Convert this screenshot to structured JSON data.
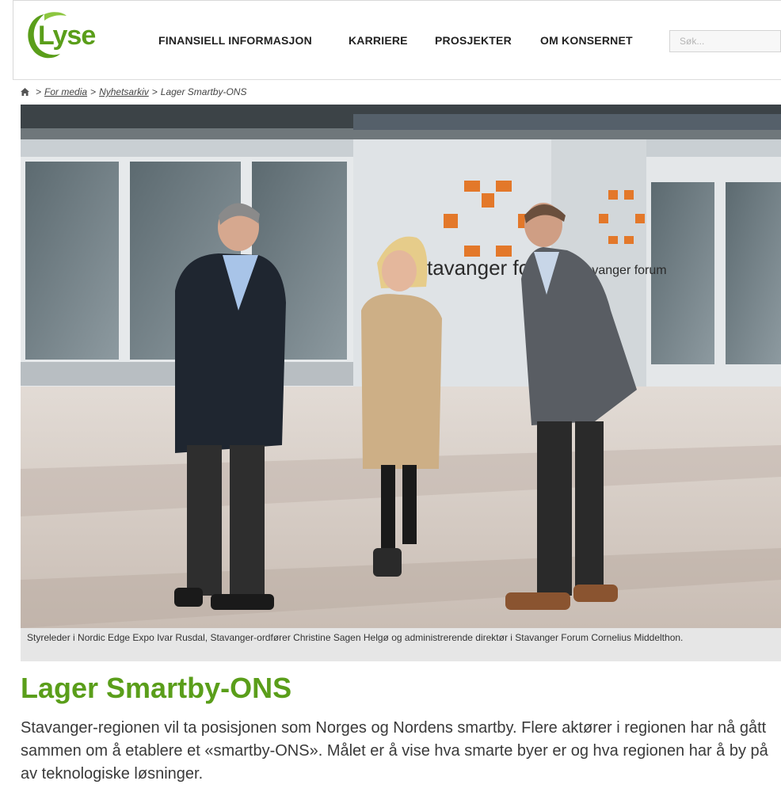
{
  "header": {
    "logo_text": "Lyse",
    "nav": [
      "FINANSIELL INFORMASJON",
      "KARRIERE",
      "PROSJEKTER",
      "OM KONSERNET"
    ],
    "search_placeholder": "Søk..."
  },
  "breadcrumb": {
    "items": [
      "For media",
      "Nyhetsarkiv",
      "Lager Smartby-ONS"
    ],
    "separator": ">"
  },
  "photo": {
    "sign_text_left": "stavanger forum",
    "sign_text_right": "stavanger forum"
  },
  "article": {
    "caption": "Styreleder i Nordic Edge Expo Ivar Rusdal, Stavanger-ordfører Christine Sagen Helgø og administrerende direktør i Stavanger Forum Cornelius Middelthon.",
    "title": "Lager Smartby-ONS",
    "lead": "Stavanger-regionen vil ta posisjonen som Norges og Nordens smartby. Flere aktører i regionen har nå gått sammen om å etablere et «smartby-ONS». Målet er å vise hva smarte byer er og hva regionen har å by på av teknologiske løsninger."
  },
  "colors": {
    "brand_green": "#5a9e1a",
    "sign_orange": "#e3782a"
  }
}
